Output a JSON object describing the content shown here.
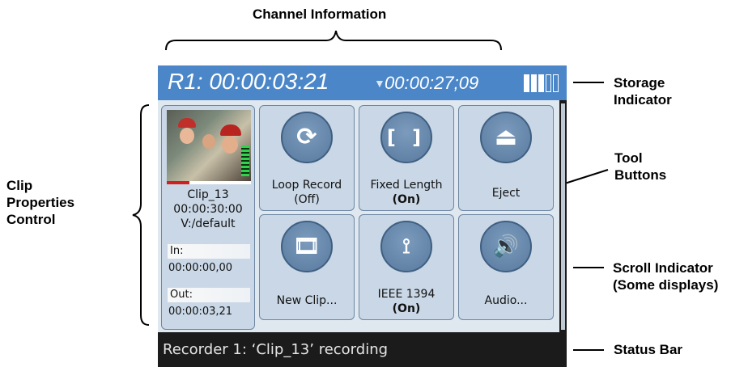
{
  "callouts": {
    "channel_information": "Channel Information",
    "storage_indicator": [
      "Storage",
      "Indicator"
    ],
    "tool_buttons": [
      "Tool",
      "Buttons"
    ],
    "scroll_indicator": [
      "Scroll Indicator",
      "(Some displays)"
    ],
    "status_bar": "Status Bar",
    "clip_properties_control": [
      "Clip",
      "Properties",
      "Control"
    ]
  },
  "channel": {
    "record_timecode": "R1: 00:00:03:21",
    "remaining_timecode": "00:00:27;09",
    "storage_bars_filled": 3,
    "storage_bars_total": 5
  },
  "clip": {
    "name": "Clip_13",
    "duration": "00:00:30:00",
    "location": "V:/default",
    "in_label": "In:",
    "in_value": "00:00:00,00",
    "out_label": "Out:",
    "out_value": "00:00:03,21",
    "progress_fraction": 0.27
  },
  "tools": [
    {
      "icon": "loop-icon",
      "label": "Loop Record",
      "sub": "(Off)",
      "sub_bold": false
    },
    {
      "icon": "fixed-length-icon",
      "label": "Fixed Length",
      "sub": "(On)",
      "sub_bold": true
    },
    {
      "icon": "eject-icon",
      "label": "Eject",
      "sub": "",
      "sub_bold": false
    },
    {
      "icon": "new-clip-icon",
      "label": "New Clip...",
      "sub": "",
      "sub_bold": false
    },
    {
      "icon": "firewire-icon",
      "label": "IEEE 1394",
      "sub": "(On)",
      "sub_bold": true
    },
    {
      "icon": "speaker-icon",
      "label": "Audio...",
      "sub": "",
      "sub_bold": false
    }
  ],
  "status": {
    "text": "Recorder 1: ‘Clip_13’ recording"
  },
  "colors": {
    "header_blue": "#4a86c8",
    "panel_bg": "#dfe7ef",
    "button_bg": "#c9d7e6",
    "status_bg": "#1b1b1b"
  }
}
